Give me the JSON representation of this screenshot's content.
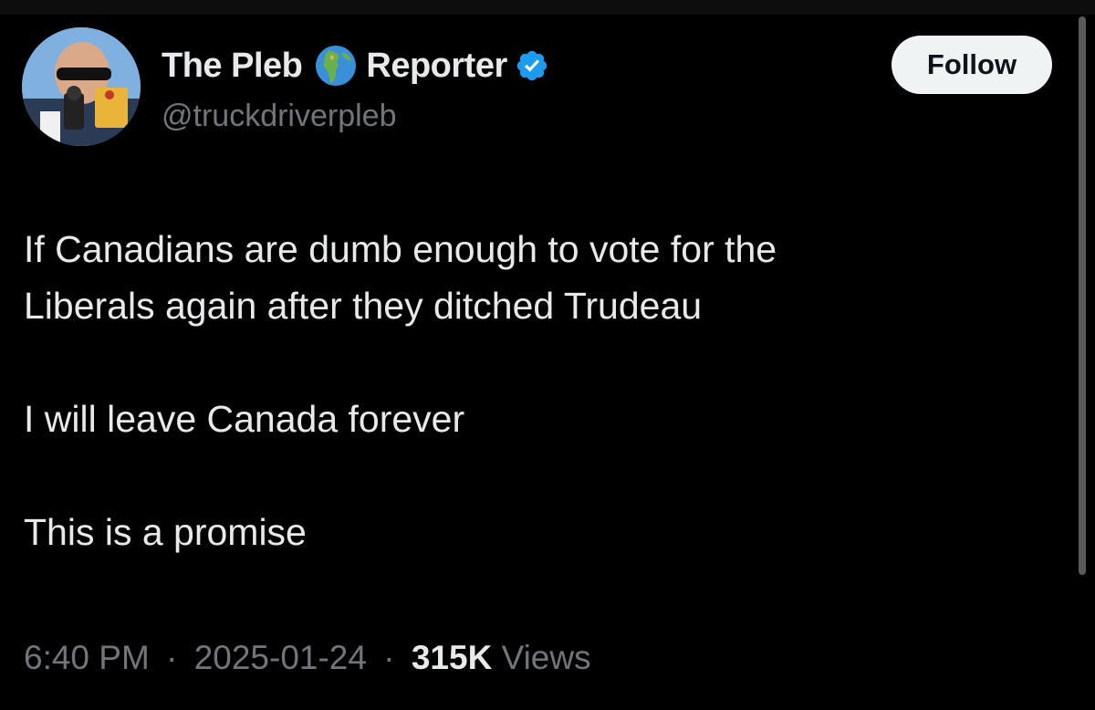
{
  "author": {
    "name_part1": "The Pleb",
    "name_part2": "Reporter",
    "handle": "@truckdriverpleb",
    "name_emoji_icon": "globe-europe-africa-icon",
    "verified_icon": "verified-badge-icon",
    "verified_color": "#1d9bf0"
  },
  "follow_button": {
    "label": "Follow"
  },
  "tweet": {
    "lines": [
      "If Canadians are dumb enough to vote for the",
      "Liberals again after they ditched Trudeau",
      "I will leave Canada forever",
      "This is a promise"
    ]
  },
  "meta": {
    "time": "6:40 PM",
    "separator": "·",
    "date": "2025-01-24",
    "views_count": "315K",
    "views_label": "Views"
  },
  "colors": {
    "background": "#000000",
    "primary_text": "#e7e9ea",
    "secondary_text": "#71767b",
    "follow_bg": "#eff3f4"
  }
}
